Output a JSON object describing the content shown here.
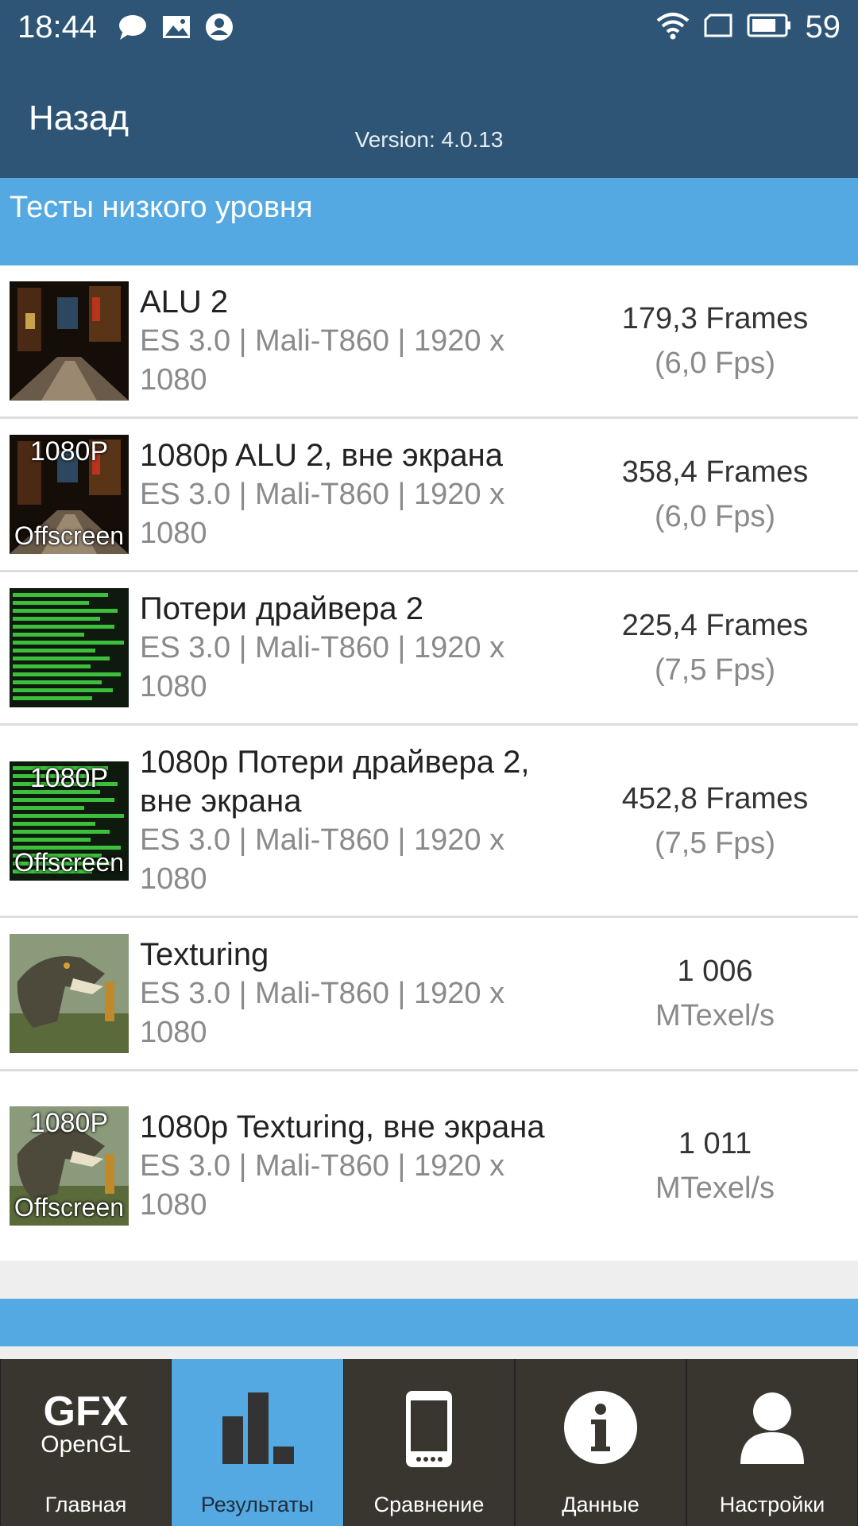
{
  "status_bar": {
    "time": "18:44",
    "battery": "59"
  },
  "app_bar": {
    "back_label": "Назад",
    "version": "Version: 4.0.13"
  },
  "section": {
    "title": "Тесты низкого уровня"
  },
  "rows": [
    {
      "name": "ALU 2",
      "desc": "ES 3.0 | Mali-T860 | 1920 x 1080",
      "result_main": "179,3 Frames",
      "result_sub": "(6,0 Fps)",
      "thumb_icon": "alu-thumbnail"
    },
    {
      "name": "1080p ALU 2, вне экрана",
      "desc": "ES 3.0 | Mali-T860 | 1920 x 1080",
      "result_main": "358,4 Frames",
      "result_sub": "(6,0 Fps)",
      "thumb_icon": "alu-offscreen-thumbnail",
      "thumb_top": "1080P",
      "thumb_bottom": "Offscreen"
    },
    {
      "name": "Потери драйвера 2",
      "desc": "ES 3.0 | Mali-T860 | 1920 x 1080",
      "result_main": "225,4 Frames",
      "result_sub": "(7,5 Fps)",
      "thumb_icon": "driver-overhead-thumbnail"
    },
    {
      "name": "1080p Потери драйвера 2, вне экрана",
      "desc": "ES 3.0 | Mali-T860 | 1920 x 1080",
      "result_main": "452,8 Frames",
      "result_sub": "(7,5 Fps)",
      "thumb_icon": "driver-overhead-offscreen-thumbnail",
      "thumb_top": "1080P",
      "thumb_bottom": "Offscreen"
    },
    {
      "name": "Texturing",
      "desc": "ES 3.0 | Mali-T860 | 1920 x 1080",
      "result_main": "1 006",
      "result_sub": "MTexel/s",
      "thumb_icon": "texturing-thumbnail"
    },
    {
      "name": "1080p Texturing, вне экрана",
      "desc": "ES 3.0 | Mali-T860 | 1920 x 1080",
      "result_main": "1 011",
      "result_sub": "MTexel/s",
      "thumb_icon": "texturing-offscreen-thumbnail",
      "thumb_top": "1080P",
      "thumb_bottom": "Offscreen"
    }
  ],
  "tabs": [
    {
      "label": "Главная",
      "icon": "gfx-opengl-logo",
      "logo_line1": "GFX",
      "logo_line2": "OpenGL"
    },
    {
      "label": "Результаты",
      "icon": "bar-chart-icon",
      "active": true
    },
    {
      "label": "Сравнение",
      "icon": "smartphone-icon"
    },
    {
      "label": "Данные",
      "icon": "info-icon"
    },
    {
      "label": "Настройки",
      "icon": "user-icon"
    }
  ]
}
